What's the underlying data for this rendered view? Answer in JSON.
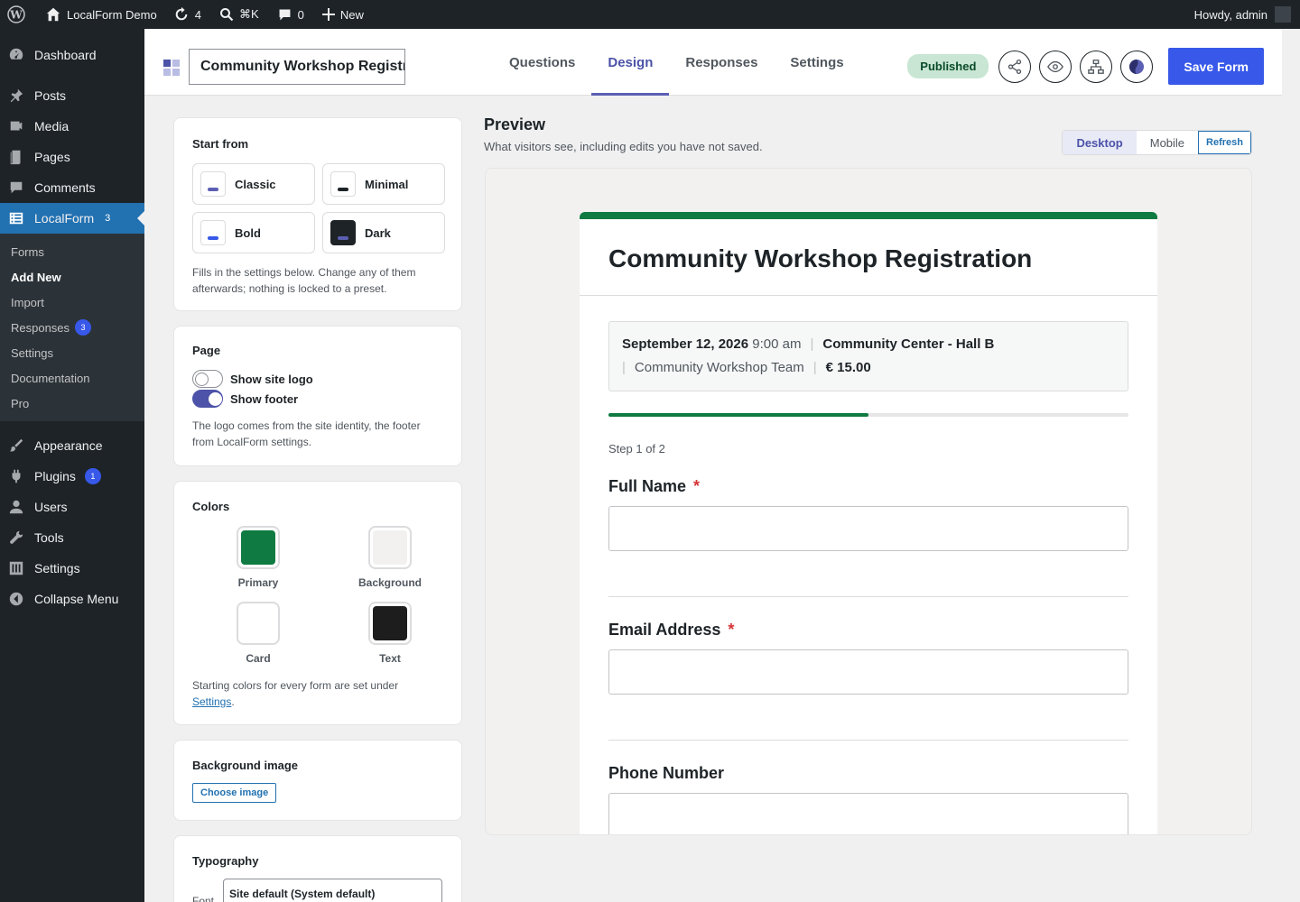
{
  "admin_bar": {
    "site_name": "LocalForm Demo",
    "updates_count": "4",
    "search_shortcut": "⌘K",
    "comments_count": "0",
    "new_label": "New",
    "greeting": "Howdy, admin"
  },
  "sidebar": {
    "items": [
      {
        "label": "Dashboard",
        "icon": "dashboard-icon"
      },
      {
        "label": "Posts",
        "icon": "pin-icon"
      },
      {
        "label": "Media",
        "icon": "media-icon"
      },
      {
        "label": "Pages",
        "icon": "pages-icon"
      },
      {
        "label": "Comments",
        "icon": "comment-icon"
      },
      {
        "label": "LocalForm",
        "icon": "form-icon",
        "count": "3"
      }
    ],
    "submenu": [
      {
        "label": "Forms"
      },
      {
        "label": "Add New"
      },
      {
        "label": "Import"
      },
      {
        "label": "Responses",
        "count": "3"
      },
      {
        "label": "Settings"
      },
      {
        "label": "Documentation"
      },
      {
        "label": "Pro"
      }
    ],
    "items_bottom": [
      {
        "label": "Appearance",
        "icon": "brush-icon"
      },
      {
        "label": "Plugins",
        "icon": "plug-icon",
        "count": "1"
      },
      {
        "label": "Users",
        "icon": "user-icon"
      },
      {
        "label": "Tools",
        "icon": "wrench-icon"
      },
      {
        "label": "Settings",
        "icon": "sliders-icon"
      },
      {
        "label": "Collapse Menu",
        "icon": "collapse-icon"
      }
    ]
  },
  "topbar": {
    "form_title_value": "Community Workshop Registr",
    "tabs": [
      {
        "label": "Questions"
      },
      {
        "label": "Design"
      },
      {
        "label": "Responses"
      },
      {
        "label": "Settings"
      }
    ],
    "status": "Published",
    "save_label": "Save Form"
  },
  "start_from": {
    "heading": "Start from",
    "presets": [
      {
        "label": "Classic",
        "accent": "#5b5fb3",
        "bg": "#ffffff"
      },
      {
        "label": "Minimal",
        "accent": "#1d2327",
        "bg": "#ffffff"
      },
      {
        "label": "Bold",
        "accent": "#3858e9",
        "bg": "#ffffff"
      },
      {
        "label": "Dark",
        "accent": "#5b5fb3",
        "bg": "#1d2327"
      }
    ],
    "help": "Fills in the settings below. Change any of them afterwards; nothing is locked to a preset."
  },
  "page_panel": {
    "heading": "Page",
    "show_logo": "Show site logo",
    "show_logo_on": false,
    "show_footer": "Show footer",
    "show_footer_on": true,
    "help": "The logo comes from the site identity, the footer from LocalForm settings."
  },
  "colors_panel": {
    "heading": "Colors",
    "colors": [
      {
        "label": "Primary",
        "value": "#0f7a41"
      },
      {
        "label": "Background",
        "value": "#f2f1f0"
      },
      {
        "label": "Card",
        "value": "#ffffff"
      },
      {
        "label": "Text",
        "value": "#1d1d1d"
      }
    ],
    "help_prefix": "Starting colors for every form are set under ",
    "help_link": "Settings",
    "help_suffix": "."
  },
  "bg_image_panel": {
    "heading": "Background image",
    "button": "Choose image"
  },
  "typography_panel": {
    "heading": "Typography",
    "font_label": "Font",
    "font_value": "Site default (System default)"
  },
  "preview": {
    "heading": "Preview",
    "subtitle": "What visitors see, including edits you have not saved.",
    "view_desktop": "Desktop",
    "view_mobile": "Mobile",
    "refresh": "Refresh"
  },
  "form_preview": {
    "title": "Community Workshop Registration",
    "date": "September 12, 2026",
    "time": "9:00 am",
    "location": "Community Center - Hall B",
    "organizer": "Community Workshop Team",
    "price": "€ 15.00",
    "progress": 0.5,
    "step": "Step 1 of 2",
    "fields": [
      {
        "label": "Full Name",
        "required": true
      },
      {
        "label": "Email Address",
        "required": true
      },
      {
        "label": "Phone Number",
        "required": false
      }
    ],
    "required_mark": "*"
  }
}
